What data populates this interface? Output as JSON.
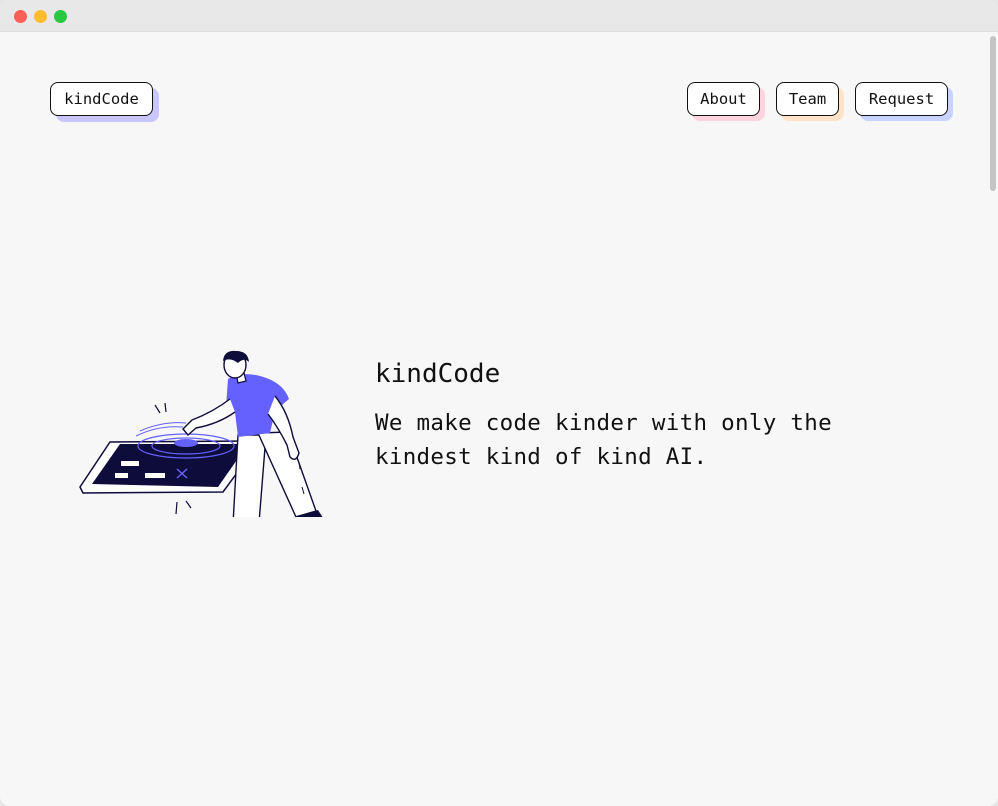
{
  "window": {
    "controls": [
      "close",
      "minimize",
      "zoom"
    ]
  },
  "nav": {
    "logo_label": "kindCode",
    "links": [
      {
        "label": "About",
        "shadow_color": "#ffd3de"
      },
      {
        "label": "Team",
        "shadow_color": "#ffe3c8"
      },
      {
        "label": "Request",
        "shadow_color": "#c8d3ff"
      }
    ],
    "logo_shadow_color": "#c9c6ff"
  },
  "hero": {
    "title": "kindCode",
    "tagline": "We make code kinder with only the kindest kind of kind AI.",
    "illustration": "person-tapping-tablet-illustration"
  },
  "colors": {
    "accent": "#6461ff",
    "ink": "#0e0c3a",
    "background": "#f7f7f7"
  }
}
